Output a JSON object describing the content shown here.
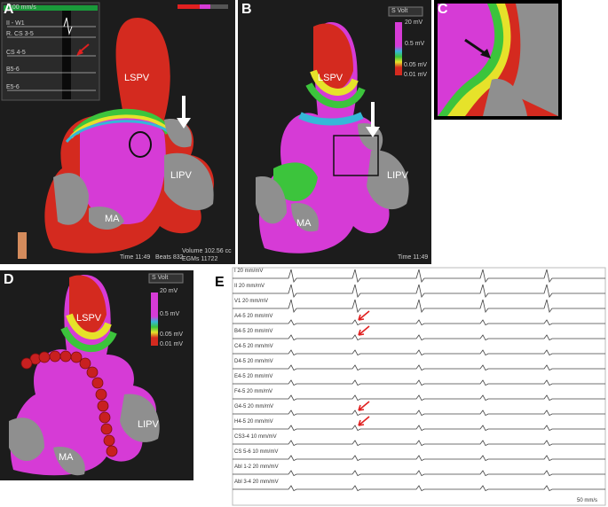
{
  "panels": {
    "A": {
      "label": "A",
      "anatomy": {
        "lspv": "LSPV",
        "lipv": "LIPV",
        "ma": "MA"
      },
      "ecg_window": {
        "speed": "100 mm/s",
        "leads": [
          "II - W1",
          "R. CS 3-5",
          "CS 4-5",
          "B5-6",
          "E5-6"
        ]
      },
      "footer": {
        "time": "Time 11:49",
        "beats": "Beats 832",
        "volume": "Volume 102.56 cc",
        "egms": "EGMs 11722"
      }
    },
    "B": {
      "label": "B",
      "anatomy": {
        "lspv": "LSPV",
        "lipv": "LIPV",
        "ma": "MA"
      },
      "voltage_scale": {
        "top": "20 mV",
        "mid": "0.5 mV",
        "low": "0.05 mV",
        "bottom": "0.01 mV",
        "dropdown": "S Volt"
      },
      "footer": {
        "time": "Time 11:49"
      }
    },
    "C": {
      "label": "C"
    },
    "D": {
      "label": "D",
      "anatomy": {
        "lspv": "LSPV",
        "lipv": "LIPV",
        "ma": "MA"
      },
      "voltage_scale": {
        "top": "20 mV",
        "mid": "0.5 mV",
        "low": "0.05 mV",
        "bottom": "0.01 mV",
        "dropdown": "S Volt"
      }
    },
    "E": {
      "label": "E",
      "traces": [
        "I 20 mm/mV",
        "II 20 mm/mV",
        "V1 20 mm/mV",
        "A4-5 20 mm/mV",
        "B4-5 20 mm/mV",
        "C4-5 20 mm/mV",
        "D4-5 20 mm/mV",
        "E4-5 20 mm/mV",
        "F4-5 20 mm/mV",
        "G4-5 20 mm/mV",
        "H4-5 20 mm/mV",
        "CS3-4 10 mm/mV",
        "CS 5-6 10 mm/mV",
        "Abl 1-2 20 mm/mV",
        "Abl 3-4 20 mm/mV"
      ],
      "speed": "50 mm/s"
    }
  },
  "colors": {
    "magenta": "#d63bd6",
    "red": "#d42a1f",
    "grey": "#8f8f8f",
    "green": "#3cc43c",
    "yellow": "#e6e22a",
    "cyan": "#35b8d8",
    "arrow_white": "#ffffff",
    "arrow_red": "#e02020"
  }
}
